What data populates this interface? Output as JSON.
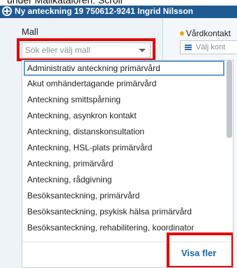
{
  "caption": "under Mallkataloren: Scroll",
  "window": {
    "title": "Ny anteckning 19 750612-9241 Ingrid Nilsson"
  },
  "left": {
    "mall_label": "Mall",
    "search_placeholder": "Sök eller välj mall"
  },
  "right": {
    "vardkontakt_label": "Vårdkontakt",
    "valj_label": "Välj kont"
  },
  "dropdown": {
    "options": [
      "Administrativ anteckning primärvård",
      "Akut omhändertagande primärvård",
      "Anteckning smittspårning",
      "Anteckning, asynkron kontakt",
      "Anteckning, distanskonsultation",
      "Anteckning, HSL-plats primärvård",
      "Anteckning, primärvård",
      "Anteckning, rådgivning",
      "Besöksanteckning, primärvård",
      "Besöksanteckning, psykisk hälsa primärvård",
      "Besöksanteckning, rehabilitering, koordinator"
    ],
    "more_label": "Visa fler"
  },
  "colors": {
    "titlebar": "#1f5b93",
    "highlight": "#e00000",
    "link": "#1a66b3",
    "status_dot": "#f0a400"
  }
}
